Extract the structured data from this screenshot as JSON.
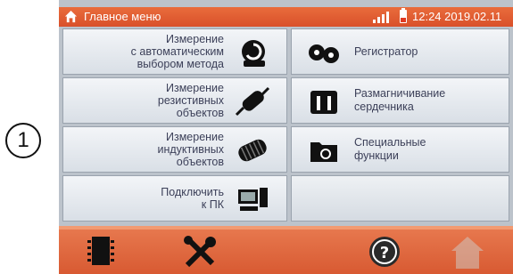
{
  "callout": "1",
  "status_bar": {
    "title": "Главное меню",
    "time": "12:24 2019.02.11",
    "icons": [
      "home-icon",
      "signal-icon",
      "battery-icon"
    ]
  },
  "menu": {
    "auto_measurement": [
      "Измерение",
      "с автоматическим",
      "выбором метода"
    ],
    "recorder": [
      "Регистратор"
    ],
    "resistive": [
      "Измерение",
      "резистивных",
      "объектов"
    ],
    "demagnetization": [
      "Размагничивание",
      "сердечника"
    ],
    "inductive": [
      "Измерение",
      "индуктивных",
      "объектов"
    ],
    "special": [
      "Специальные",
      "функции"
    ],
    "connect_pc": [
      "Подключить",
      "к ПК"
    ]
  },
  "bottom_bar": {
    "buttons": [
      "memory-icon",
      "tools-icon",
      "help-icon",
      "home-icon"
    ]
  },
  "colors": {
    "accent": "#d9502a",
    "tile": "#e6eaef",
    "text": "#3b3f58",
    "background": "#bcc3cb"
  }
}
